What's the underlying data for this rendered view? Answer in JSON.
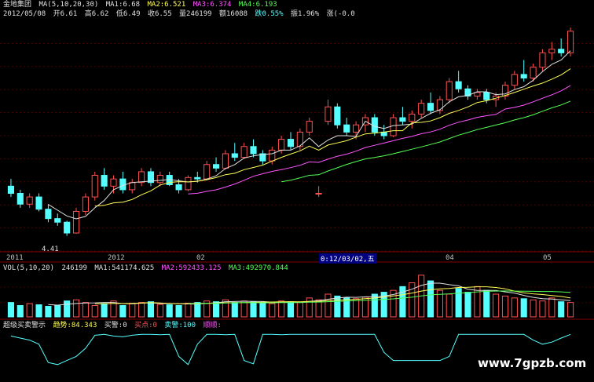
{
  "header": {
    "title": "金地集团",
    "ma_label": "MA(5,10,20,30)",
    "ma1": "MA1:6.68",
    "ma2": "MA2:6.521",
    "ma3": "MA3:6.374",
    "ma4": "MA4:6.193",
    "date": "2012/05/08",
    "open": "开6.61",
    "high": "高6.62",
    "low": "低6.49",
    "close": "收6.55",
    "volume": "量246199",
    "amount": "额16088",
    "change": "跌0.55%",
    "amplitude": "振1.96%",
    "extra": "涨(-0.0"
  },
  "volume_header": {
    "label": "VOL(5,10,20)",
    "value": "246199",
    "ma1": "MA1:541174.625",
    "ma2": "MA2:592433.125",
    "ma3": "MA3:492970.844"
  },
  "indicator_header": {
    "name": "超级买卖警示",
    "trend": "趋势:84.343",
    "buy_alert": "买警:0",
    "buy_point": "买点:0",
    "sell_alert": "卖警:100",
    "smooth": "顺顺:"
  },
  "axis": {
    "labels": [
      "2011",
      "2012",
      "02",
      "04",
      "05"
    ],
    "cursor": "0:12/03/02,五"
  },
  "low_label": "4.41",
  "watermark": "www.7gpzb.com",
  "colors": {
    "up": "#ff5050",
    "down": "#55ffff",
    "ma1": "#e0e0e0",
    "ma2": "#ffff55",
    "ma3": "#ff55ff",
    "ma4": "#55ff55",
    "grid": "#800000"
  },
  "chart_data": {
    "type": "candlestick",
    "price_range": [
      4.2,
      7.4
    ],
    "volume_max": 1200000,
    "indicator_range": [
      0,
      100
    ],
    "candles": [
      [
        5.1,
        5.2,
        4.95,
        5.0
      ],
      [
        5.0,
        5.05,
        4.8,
        4.85
      ],
      [
        4.85,
        5.0,
        4.8,
        4.95
      ],
      [
        4.95,
        5.0,
        4.75,
        4.78
      ],
      [
        4.78,
        4.85,
        4.6,
        4.65
      ],
      [
        4.65,
        4.72,
        4.55,
        4.6
      ],
      [
        4.6,
        4.62,
        4.41,
        4.45
      ],
      [
        4.45,
        4.8,
        4.44,
        4.75
      ],
      [
        4.75,
        5.0,
        4.7,
        4.95
      ],
      [
        4.95,
        5.3,
        4.9,
        5.25
      ],
      [
        5.25,
        5.35,
        5.05,
        5.1
      ],
      [
        5.1,
        5.25,
        5.0,
        5.2
      ],
      [
        5.2,
        5.3,
        5.0,
        5.05
      ],
      [
        5.05,
        5.2,
        5.0,
        5.15
      ],
      [
        5.15,
        5.35,
        5.1,
        5.3
      ],
      [
        5.3,
        5.35,
        5.1,
        5.15
      ],
      [
        5.15,
        5.3,
        5.1,
        5.25
      ],
      [
        5.25,
        5.3,
        5.1,
        5.12
      ],
      [
        5.12,
        5.2,
        5.0,
        5.05
      ],
      [
        5.05,
        5.25,
        5.03,
        5.22
      ],
      [
        5.22,
        5.3,
        5.15,
        5.2
      ],
      [
        5.2,
        5.45,
        5.18,
        5.4
      ],
      [
        5.4,
        5.5,
        5.3,
        5.35
      ],
      [
        5.35,
        5.6,
        5.33,
        5.55
      ],
      [
        5.55,
        5.7,
        5.45,
        5.5
      ],
      [
        5.5,
        5.7,
        5.48,
        5.65
      ],
      [
        5.65,
        5.75,
        5.5,
        5.55
      ],
      [
        5.55,
        5.6,
        5.4,
        5.45
      ],
      [
        5.45,
        5.65,
        5.4,
        5.6
      ],
      [
        5.6,
        5.8,
        5.55,
        5.75
      ],
      [
        5.75,
        5.85,
        5.6,
        5.65
      ],
      [
        5.65,
        5.9,
        5.6,
        5.85
      ],
      [
        5.85,
        6.05,
        5.8,
        6.0
      ],
      [
        5.0,
        5.1,
        4.95,
        5.0
      ],
      [
        6.0,
        6.3,
        5.95,
        6.2
      ],
      [
        6.2,
        6.25,
        5.9,
        5.95
      ],
      [
        5.95,
        6.05,
        5.8,
        5.85
      ],
      [
        5.85,
        6.0,
        5.75,
        5.95
      ],
      [
        5.95,
        6.1,
        5.85,
        6.05
      ],
      [
        6.05,
        6.1,
        5.8,
        5.85
      ],
      [
        5.85,
        5.95,
        5.75,
        5.8
      ],
      [
        5.8,
        6.1,
        5.78,
        6.05
      ],
      [
        6.05,
        6.2,
        5.95,
        6.0
      ],
      [
        6.0,
        6.15,
        5.9,
        6.1
      ],
      [
        6.1,
        6.3,
        6.05,
        6.25
      ],
      [
        6.25,
        6.4,
        6.1,
        6.15
      ],
      [
        6.15,
        6.35,
        6.1,
        6.3
      ],
      [
        6.3,
        6.6,
        6.25,
        6.55
      ],
      [
        6.55,
        6.7,
        6.4,
        6.45
      ],
      [
        6.45,
        6.5,
        6.3,
        6.35
      ],
      [
        6.35,
        6.45,
        6.3,
        6.4
      ],
      [
        6.4,
        6.45,
        6.25,
        6.3
      ],
      [
        6.3,
        6.4,
        6.2,
        6.35
      ],
      [
        6.35,
        6.55,
        6.3,
        6.5
      ],
      [
        6.5,
        6.7,
        6.45,
        6.65
      ],
      [
        6.65,
        6.85,
        6.55,
        6.6
      ],
      [
        6.6,
        6.8,
        6.55,
        6.75
      ],
      [
        6.75,
        7.0,
        6.7,
        6.95
      ],
      [
        6.95,
        7.1,
        6.85,
        7.0
      ],
      [
        7.0,
        7.15,
        6.9,
        6.95
      ],
      [
        6.95,
        7.3,
        6.9,
        7.25
      ]
    ],
    "volumes": [
      380000,
      300000,
      350000,
      320000,
      280000,
      300000,
      420000,
      450000,
      380000,
      300000,
      350000,
      420000,
      300000,
      360000,
      380000,
      400000,
      330000,
      320000,
      300000,
      360000,
      380000,
      420000,
      400000,
      450000,
      380000,
      420000,
      400000,
      380000,
      350000,
      420000,
      400000,
      380000,
      500000,
      450000,
      600000,
      550000,
      500000,
      480000,
      520000,
      600000,
      650000,
      700000,
      800000,
      900000,
      1100000,
      950000,
      700000,
      600000,
      750000,
      650000,
      800000,
      700000,
      600000,
      550000,
      500000,
      480000,
      450000,
      420000,
      500000,
      400000,
      380000
    ],
    "indicator": [
      80,
      75,
      70,
      60,
      15,
      10,
      20,
      30,
      50,
      82,
      84,
      80,
      78,
      82,
      84,
      84,
      83,
      84,
      30,
      10,
      60,
      84,
      84,
      83,
      84,
      20,
      12,
      84,
      84,
      83,
      84,
      84,
      84,
      84,
      84,
      84,
      84,
      84,
      84,
      84,
      40,
      20,
      20,
      20,
      20,
      20,
      20,
      30,
      84,
      84,
      84,
      84,
      84,
      84,
      84,
      84,
      70,
      60,
      65,
      75,
      84
    ]
  }
}
